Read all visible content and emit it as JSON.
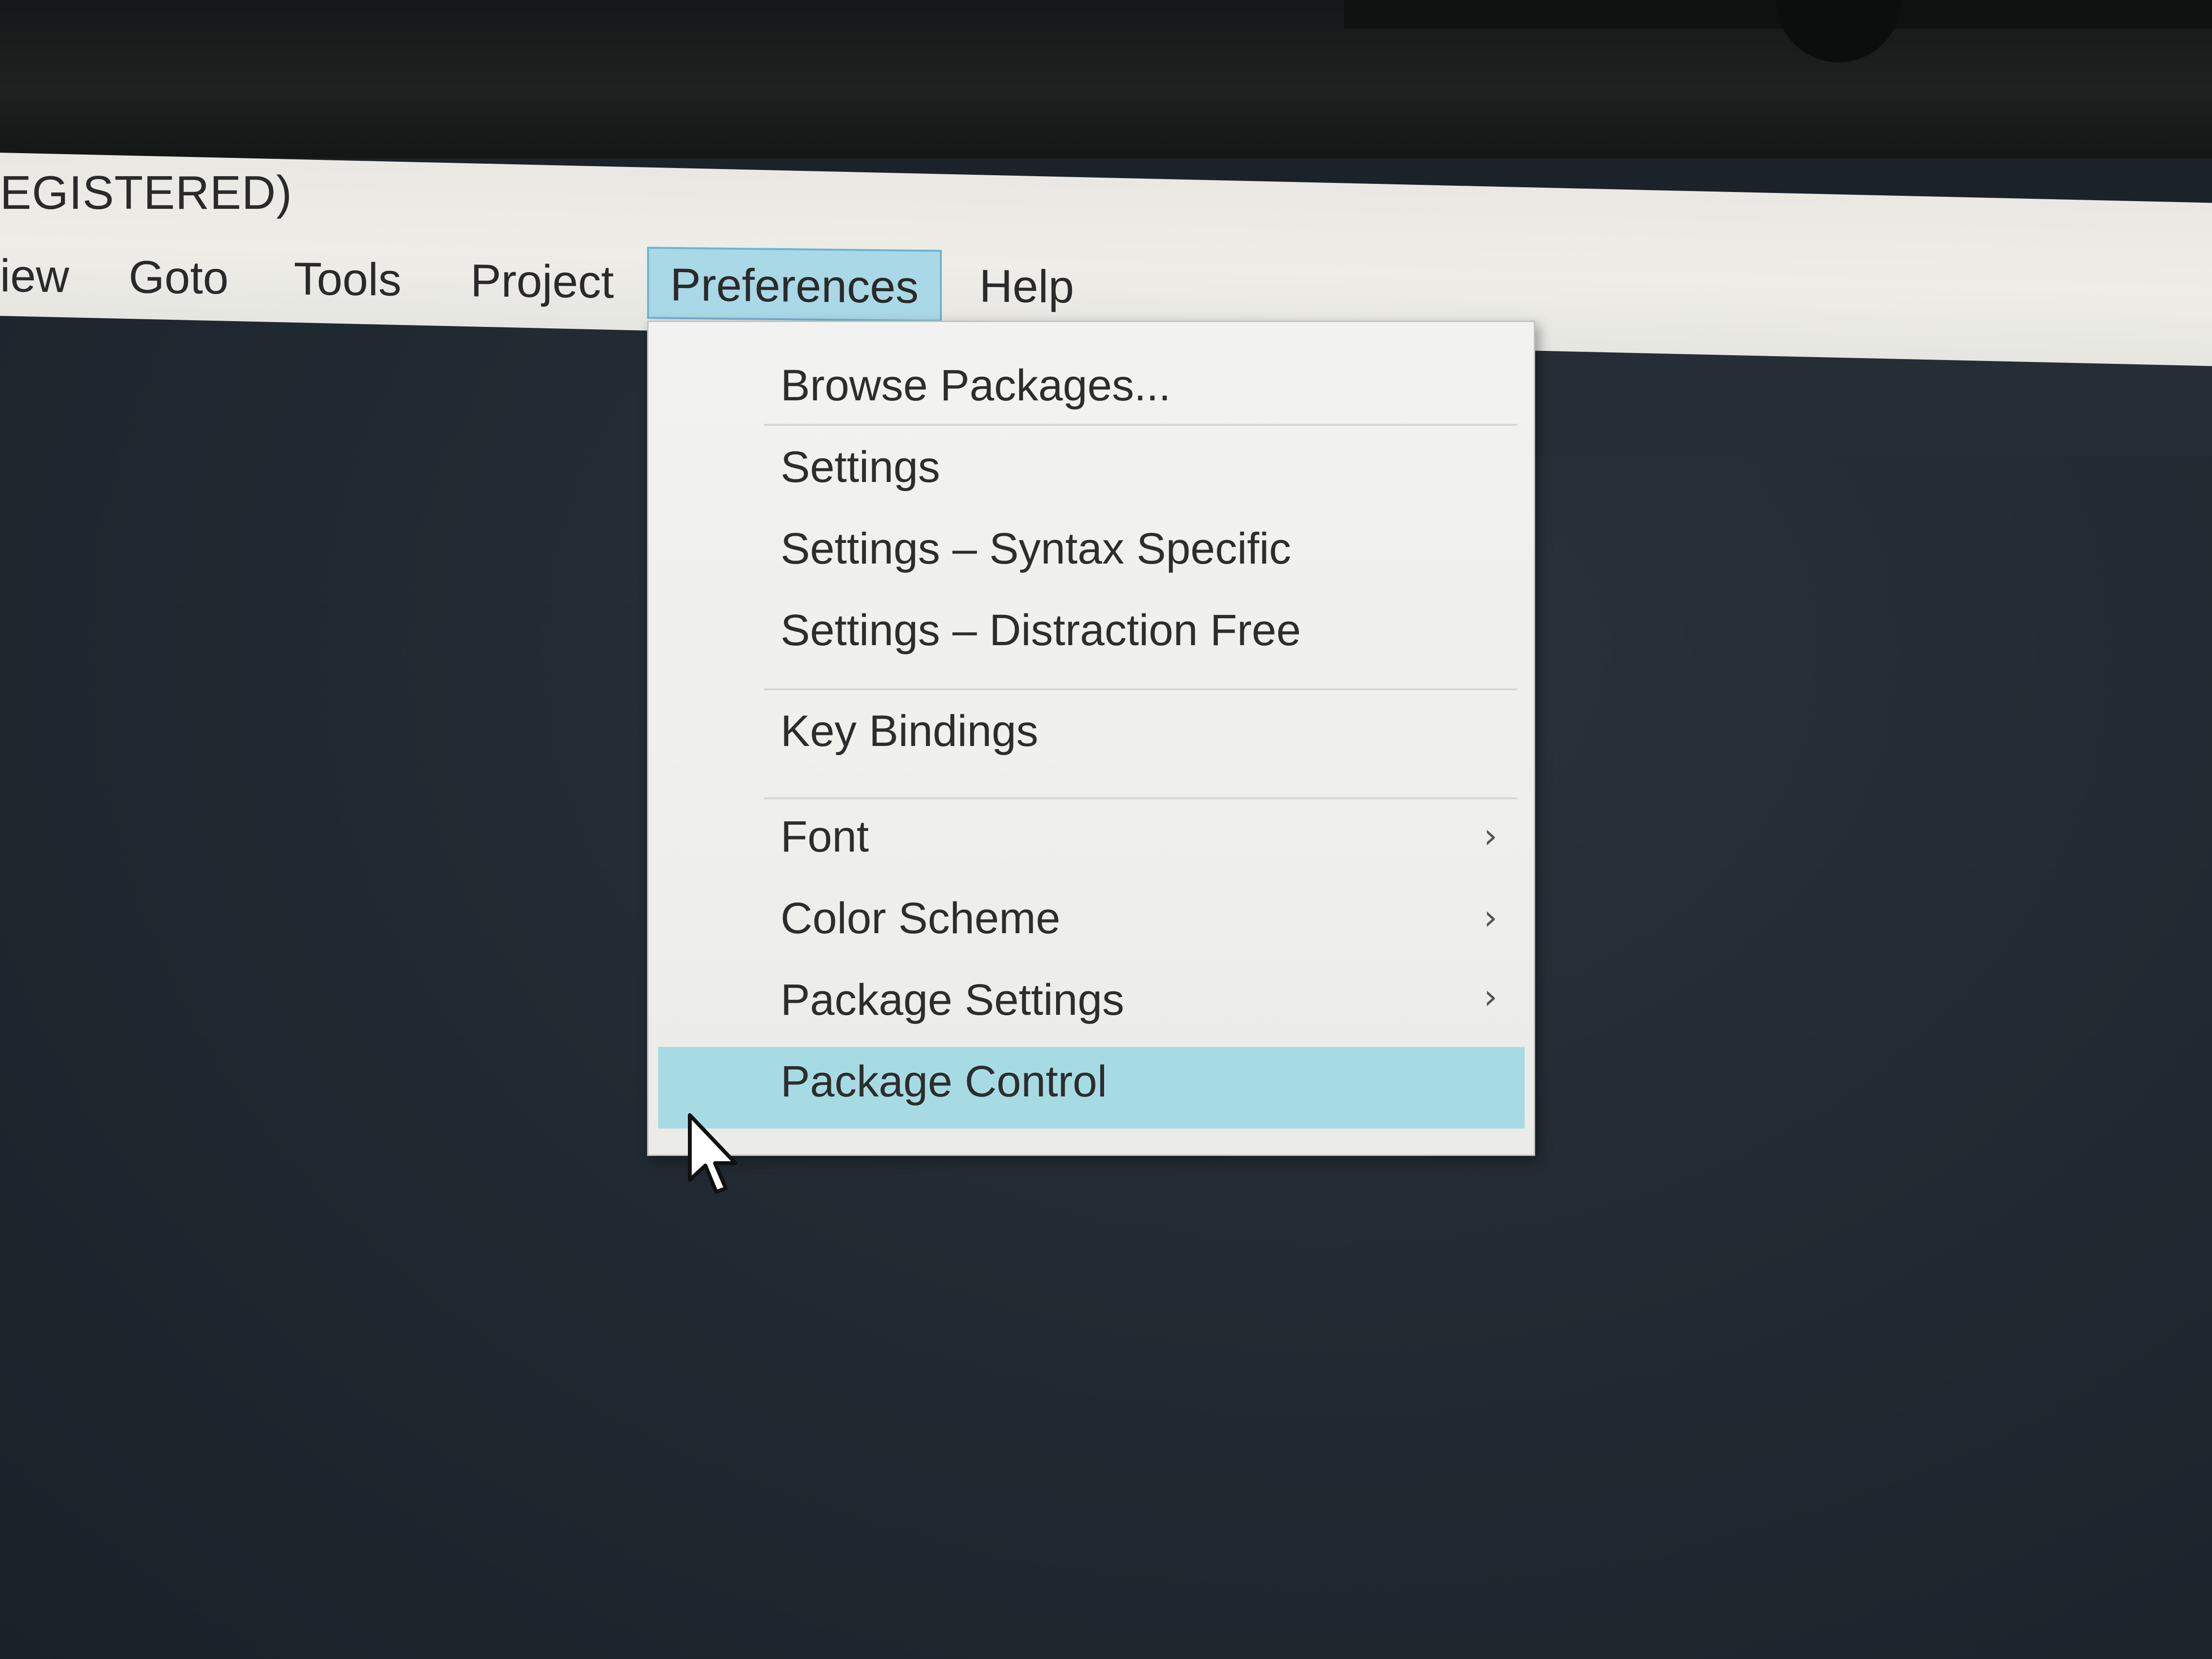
{
  "window": {
    "title": "EGISTERED)"
  },
  "menubar": {
    "items": [
      {
        "label": "iew"
      },
      {
        "label": "Goto"
      },
      {
        "label": "Tools"
      },
      {
        "label": "Project"
      },
      {
        "label": "Preferences"
      },
      {
        "label": "Help"
      }
    ],
    "active": "Preferences"
  },
  "preferences_menu": {
    "items": [
      {
        "label": "Browse Packages..."
      },
      {
        "label": "Settings"
      },
      {
        "label": "Settings – Syntax Specific"
      },
      {
        "label": "Settings – Distraction Free"
      },
      {
        "label": "Key Bindings"
      },
      {
        "label": "Font"
      },
      {
        "label": "Color Scheme"
      },
      {
        "label": "Package Settings"
      },
      {
        "label": "Package Control"
      }
    ],
    "highlighted": "Package Control",
    "submenu_icon": "chevron-right-icon"
  },
  "colors": {
    "menu_active_bg": "#a9d8e6",
    "menu_highlight_bg": "#a7dbe3",
    "editor_bg": "#222a33",
    "menu_bg": "#efefec"
  },
  "cursor_icon": "mouse-pointer-icon"
}
